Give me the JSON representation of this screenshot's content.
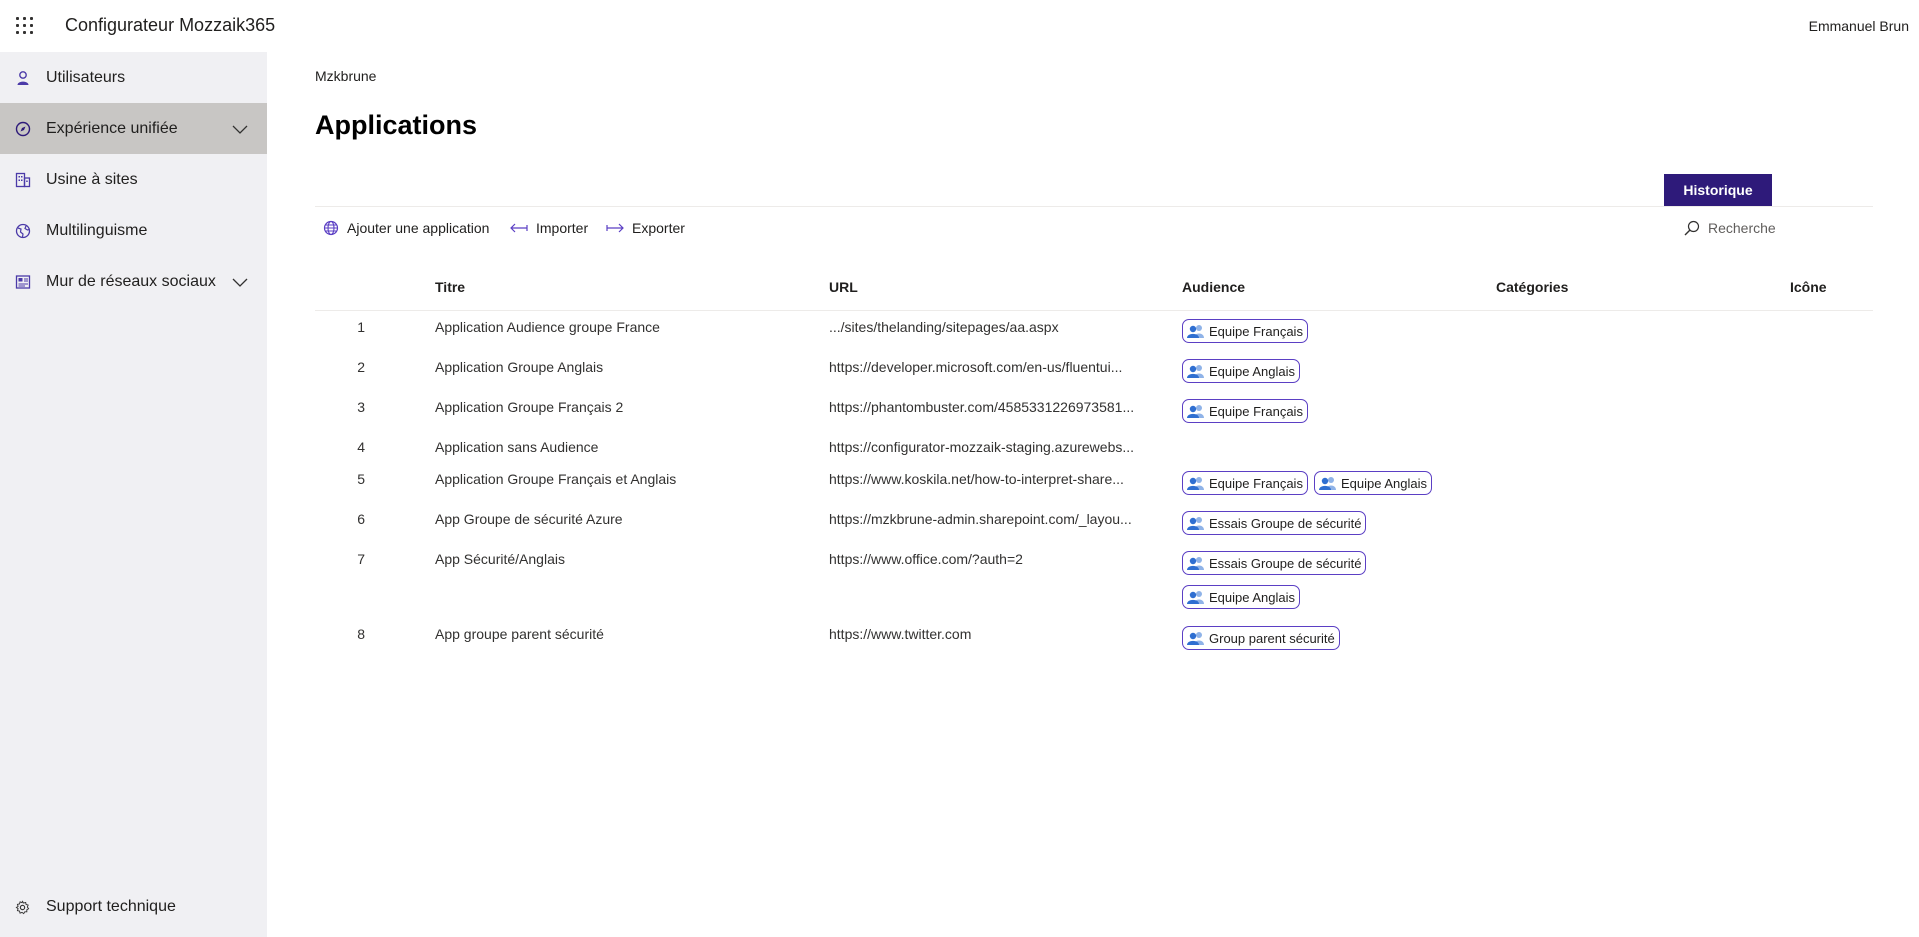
{
  "topbar": {
    "app_title": "Configurateur Mozzaik365",
    "user_name": "Emmanuel Brun",
    "waffle_icon": "waffle-icon"
  },
  "sidebar": {
    "items": [
      {
        "label": "Utilisateurs",
        "icon": "user-icon",
        "active": false,
        "expandable": false
      },
      {
        "label": "Expérience unifiée",
        "icon": "compass-icon",
        "active": true,
        "expandable": true
      },
      {
        "label": "Usine à sites",
        "icon": "building-icon",
        "active": false,
        "expandable": false
      },
      {
        "label": "Multilinguisme",
        "icon": "globe-icon",
        "active": false,
        "expandable": false
      },
      {
        "label": "Mur de réseaux sociaux",
        "icon": "board-icon",
        "active": false,
        "expandable": true
      }
    ],
    "support_label": "Support technique",
    "support_icon": "gear-icon"
  },
  "main": {
    "breadcrumb": "Mzkbrune",
    "title": "Applications",
    "historique_label": "Historique",
    "commands": {
      "add": "Ajouter une application",
      "import": "Importer",
      "export": "Exporter"
    },
    "search_placeholder": "Recherche"
  },
  "table": {
    "columns": {
      "title": "Titre",
      "url": "URL",
      "audience": "Audience",
      "categories": "Catégories",
      "icon": "Icône"
    },
    "rows": [
      {
        "num": "1",
        "title": "Application Audience groupe France",
        "url": ".../sites/thelanding/sitepages/aa.aspx",
        "audience": [
          "Equipe Français"
        ]
      },
      {
        "num": "2",
        "title": "Application Groupe Anglais",
        "url": "https://developer.microsoft.com/en-us/fluentui...",
        "audience": [
          "Equipe Anglais"
        ]
      },
      {
        "num": "3",
        "title": "Application Groupe Français 2",
        "url": "https://phantombuster.com/4585331226973581...",
        "audience": [
          "Equipe Français"
        ]
      },
      {
        "num": "4",
        "title": "Application sans Audience",
        "url": "https://configurator-mozzaik-staging.azurewebs...",
        "audience": []
      },
      {
        "num": "5",
        "title": "Application Groupe Français et Anglais",
        "url": "https://www.koskila.net/how-to-interpret-share...",
        "audience": [
          "Equipe Français",
          "Equipe Anglais"
        ]
      },
      {
        "num": "6",
        "title": "App Groupe de sécurité Azure",
        "url": "https://mzkbrune-admin.sharepoint.com/_layou...",
        "audience": [
          "Essais Groupe de sécurité"
        ]
      },
      {
        "num": "7",
        "title": "App Sécurité/Anglais",
        "url": "https://www.office.com/?auth=2",
        "audience": [
          "Essais Groupe de sécurité",
          "Equipe Anglais"
        ]
      },
      {
        "num": "8",
        "title": "App groupe parent sécurité",
        "url": "https://www.twitter.com",
        "audience": [
          "Group parent sécurité"
        ]
      }
    ]
  }
}
